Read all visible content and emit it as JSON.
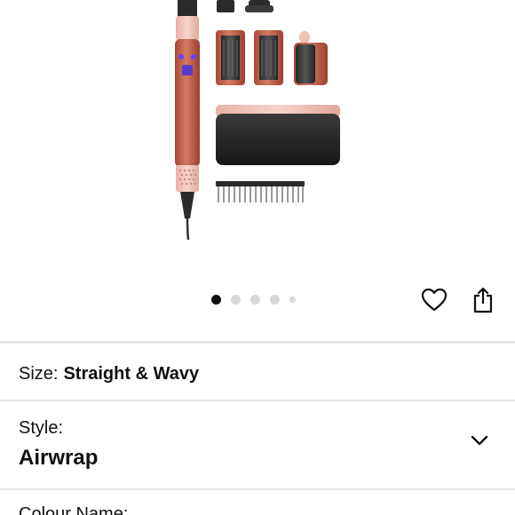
{
  "product": {
    "image_alt": "hair styler with attachments, case and comb",
    "carousel": {
      "count": 5,
      "active_index": 0
    }
  },
  "actions": {
    "favorite_icon": "heart-icon",
    "share_icon": "share-icon"
  },
  "size": {
    "label": "Size:",
    "value": "Straight & Wavy"
  },
  "style": {
    "label": "Style:",
    "value": "Airwrap",
    "icon": "chevron-down-icon"
  },
  "colour": {
    "label": "Colour Name:"
  },
  "colors": {
    "product_body": "#c2604a",
    "product_accent": "#f3c8bd",
    "case": "#2a2a2a",
    "dot_active": "#0f1111",
    "dot_inactive": "#d5d9d9",
    "divider": "#e3e6e6"
  }
}
